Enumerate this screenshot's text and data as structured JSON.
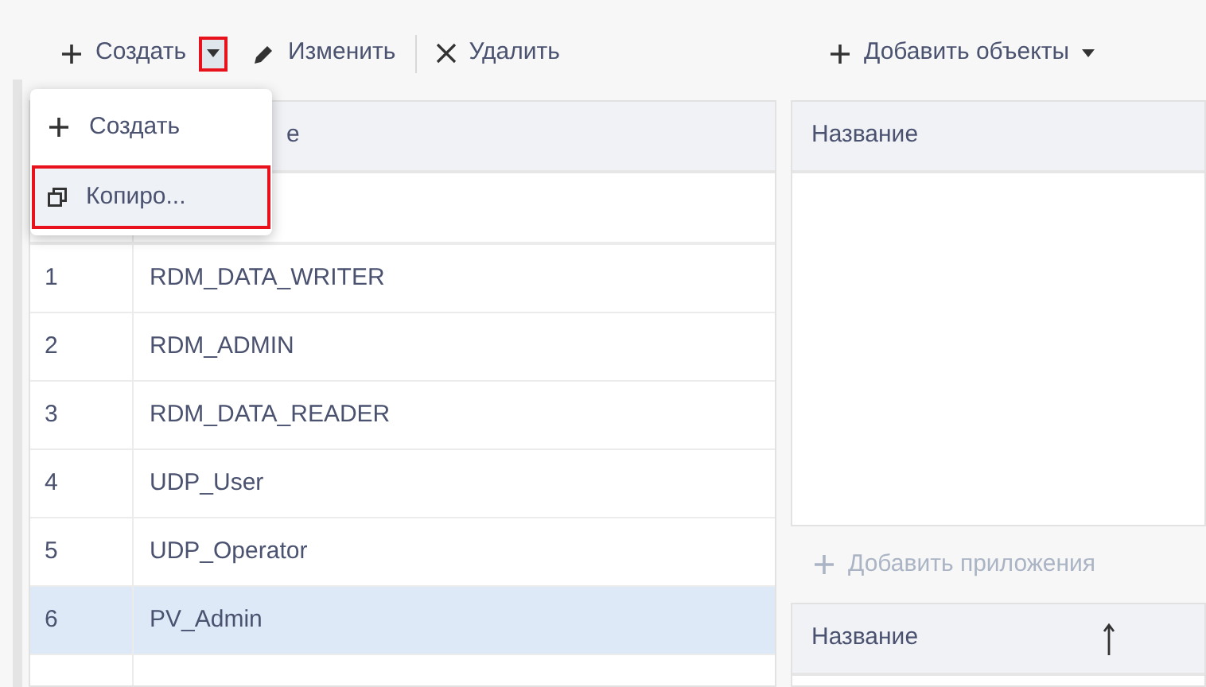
{
  "toolbar": {
    "items": [
      {
        "kind": "create",
        "label": "Создать"
      },
      {
        "kind": "split",
        "highlighted": true,
        "menu_open": true
      },
      {
        "kind": "edit",
        "label": "Изменить"
      },
      {
        "kind": "separator"
      },
      {
        "kind": "delete",
        "label": "Удалить"
      }
    ]
  },
  "dropdown_menu": {
    "items": [
      {
        "kind": "create",
        "label": "Создать",
        "highlighted": false
      },
      {
        "kind": "copy",
        "label": "Копиро...",
        "highlighted": true
      }
    ]
  },
  "roles_table": {
    "header_visible_text": "е",
    "rows": [
      {
        "number": "1",
        "name": "RDM_DATA_WRITER",
        "selected": false
      },
      {
        "number": "2",
        "name": "RDM_ADMIN",
        "selected": false
      },
      {
        "number": "3",
        "name": "RDM_DATA_READER",
        "selected": false
      },
      {
        "number": "4",
        "name": "UDP_User",
        "selected": false
      },
      {
        "number": "5",
        "name": "UDP_Operator",
        "selected": false
      },
      {
        "number": "6",
        "name": "PV_Admin",
        "selected": true
      }
    ]
  },
  "objects_panel": {
    "add_button": {
      "label": "Добавить объекты"
    },
    "column": "Название"
  },
  "apps_panel": {
    "add_button": {
      "label": "Добавить приложения",
      "disabled": true
    },
    "column": "Название",
    "sorted_ascending": true
  }
}
